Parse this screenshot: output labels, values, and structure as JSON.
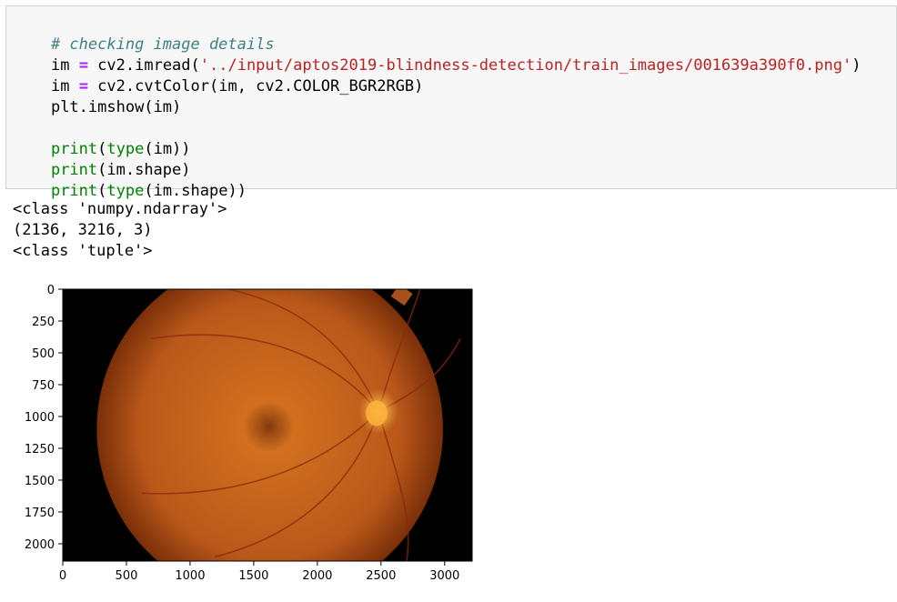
{
  "cell": {
    "comment": "# checking image details",
    "line1": {
      "var": "im",
      "eq": "=",
      "call": " cv2.imread(",
      "path": "'../input/aptos2019-blindness-detection/train_images/001639a390f0.png'",
      "close": ")"
    },
    "line2": {
      "var": "im",
      "eq": "=",
      "rest": " cv2.cvtColor(im, cv2.COLOR_BGR2RGB)"
    },
    "line3": "plt.imshow(im)",
    "prints": [
      {
        "fn": "print",
        "open": "(",
        "inner_fn": "type",
        "arg": "(im))"
      },
      {
        "fn": "print",
        "open": "(im.shape)",
        "inner_fn": "",
        "arg": ""
      },
      {
        "fn": "print",
        "open": "(",
        "inner_fn": "type",
        "arg": "(im.shape))"
      }
    ]
  },
  "output": {
    "lines": [
      "<class 'numpy.ndarray'>",
      "(2136, 3216, 3)",
      "<class 'tuple'>"
    ]
  },
  "chart_data": {
    "type": "heatmap",
    "image_width": 3216,
    "image_height": 2136,
    "xlim": [
      0,
      3216
    ],
    "ylim": [
      2136,
      0
    ],
    "x_ticks": [
      0,
      500,
      1000,
      1500,
      2000,
      2500,
      3000
    ],
    "y_ticks": [
      0,
      250,
      500,
      750,
      1000,
      1250,
      1500,
      1750,
      2000
    ],
    "x_tick_labels": [
      "0",
      "500",
      "1000",
      "1500",
      "2000",
      "2500",
      "3000"
    ],
    "y_tick_labels": [
      "0",
      "250",
      "500",
      "750",
      "1000",
      "1250",
      "1500",
      "1750",
      "2000"
    ],
    "fundus_center": [
      1627,
      1100
    ],
    "fundus_radius": 1360,
    "optic_disc_center": [
      2480,
      960
    ],
    "fovea_center": [
      1620,
      1080
    ]
  },
  "colors": {
    "background": "#000000",
    "fundus_center": "#d7751f",
    "fundus_edge": "#7a2f08",
    "optic_disc": "#ffb23a",
    "vessel": "#8a2a0d"
  }
}
